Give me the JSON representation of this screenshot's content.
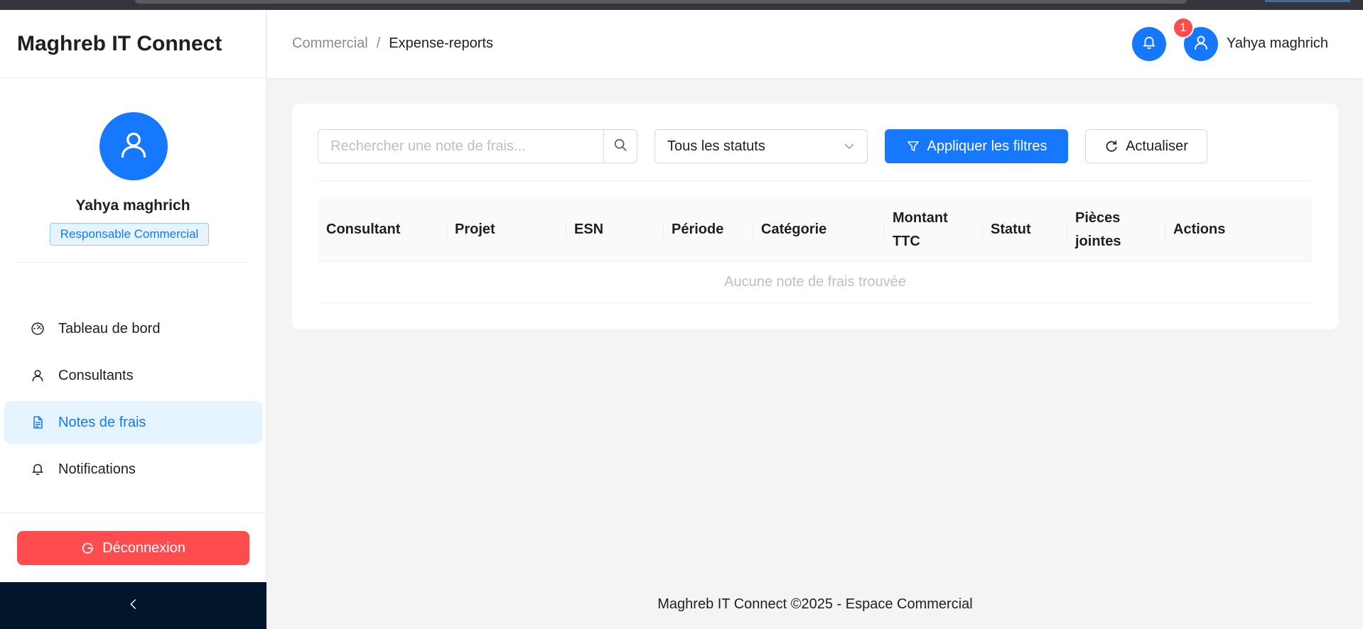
{
  "app": {
    "brand": "Maghreb IT Connect"
  },
  "profile": {
    "name": "Yahya maghrich",
    "role": "Responsable Commercial"
  },
  "menu": {
    "items": [
      {
        "label": "Tableau de bord",
        "icon": "dashboard-icon"
      },
      {
        "label": "Consultants",
        "icon": "user-icon"
      },
      {
        "label": "Notes de frais",
        "icon": "file-text-icon",
        "active": true
      },
      {
        "label": "Notifications",
        "icon": "bell-icon"
      }
    ]
  },
  "sidebar": {
    "logout_label": "Déconnexion"
  },
  "header": {
    "breadcrumb": [
      "Commercial",
      "Expense-reports"
    ],
    "breadcrumb_divider": "/",
    "notification_count": "1",
    "user_name": "Yahya maghrich"
  },
  "filters": {
    "search_placeholder": "Rechercher une note de frais...",
    "search_value": "",
    "status_selected": "Tous les statuts",
    "apply_label": "Appliquer les filtres",
    "refresh_label": "Actualiser"
  },
  "table": {
    "columns": [
      "Consultant",
      "Projet",
      "ESN",
      "Période",
      "Catégorie",
      "Montant TTC",
      "Statut",
      "Pièces jointes",
      "Actions"
    ],
    "empty_text": "Aucune note de frais trouvée"
  },
  "footer": {
    "text": "Maghreb IT Connect ©2025 - Espace Commercial"
  },
  "colors": {
    "primary": "#1677ff",
    "danger": "#ff4d4f",
    "dark": "#001529"
  }
}
